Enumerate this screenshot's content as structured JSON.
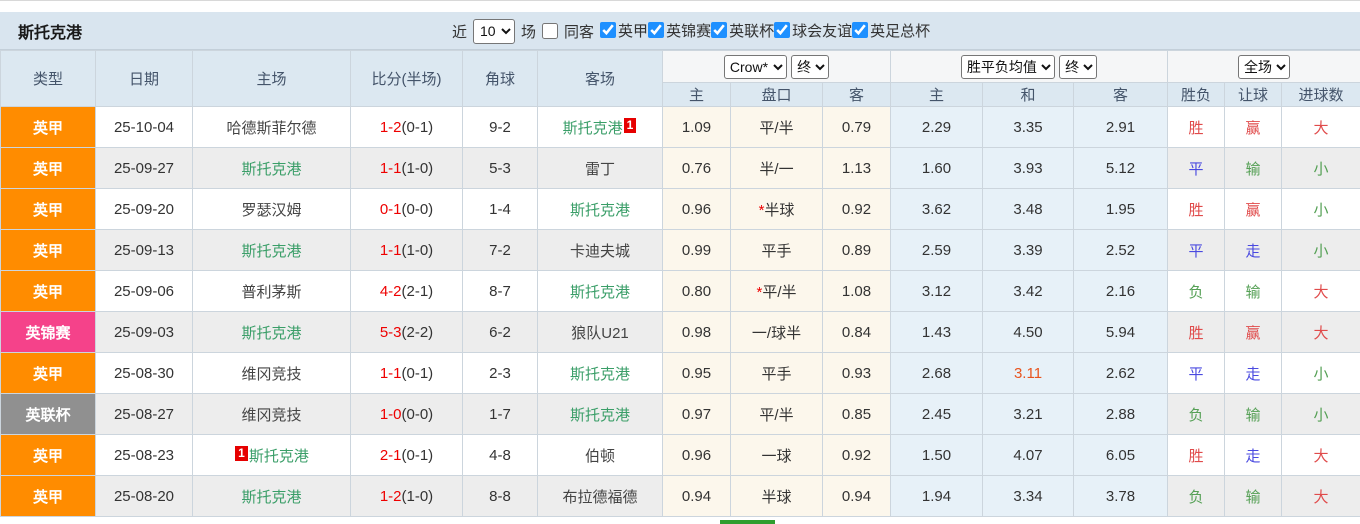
{
  "page": {
    "team_title": "斯托克港"
  },
  "filter_bar": {
    "near_label": "近",
    "match_count": "10",
    "games_label": "场",
    "same_away_label": "同客",
    "same_away_checked": false,
    "competitions": [
      {
        "label": "英甲",
        "checked": true
      },
      {
        "label": "英锦赛",
        "checked": true
      },
      {
        "label": "英联杯",
        "checked": true
      },
      {
        "label": "球会友谊",
        "checked": true
      },
      {
        "label": "英足总杯",
        "checked": true
      }
    ]
  },
  "table": {
    "headers": {
      "type": "类型",
      "date": "日期",
      "home": "主场",
      "score": "比分(半场)",
      "corner": "角球",
      "away": "客场",
      "odds_group": {
        "bookmaker_select": "Crow*",
        "status_select": "终",
        "sub": [
          "主",
          "盘口",
          "客"
        ]
      },
      "avg_group": {
        "metric_select": "胜平负均值",
        "status_select": "终",
        "sub": [
          "主",
          "和",
          "客"
        ]
      },
      "result_group": {
        "scope_select": "全场",
        "sub": [
          "胜负",
          "让球",
          "进球数"
        ]
      }
    },
    "league_colors": {
      "英甲": "#ff8c00",
      "英锦赛": "#f5428a",
      "英联杯": "#909090"
    },
    "rows": [
      {
        "league": "英甲",
        "date": "25-10-04",
        "home": {
          "name": "哈德斯菲尔德",
          "is_focus": false,
          "badge": null,
          "badge_pos": null
        },
        "score_ft": "1-2",
        "score_ht": "(0-1)",
        "corners": "9-2",
        "away": {
          "name": "斯托克港",
          "is_focus": true,
          "badge": "1",
          "badge_pos": "after"
        },
        "odds": {
          "home": "1.09",
          "handicap": "平/半",
          "star": false,
          "away": "0.79"
        },
        "avg": {
          "home": "2.29",
          "draw": "3.35",
          "away": "2.91",
          "draw_highlight": false
        },
        "result": {
          "win": "胜",
          "win_color": "red",
          "handicap": "赢",
          "handicap_color": "red",
          "goals": "大",
          "goals_color": "red"
        }
      },
      {
        "league": "英甲",
        "date": "25-09-27",
        "home": {
          "name": "斯托克港",
          "is_focus": true,
          "badge": null,
          "badge_pos": null
        },
        "score_ft": "1-1",
        "score_ht": "(1-0)",
        "corners": "5-3",
        "away": {
          "name": "雷丁",
          "is_focus": false,
          "badge": null,
          "badge_pos": null
        },
        "odds": {
          "home": "0.76",
          "handicap": "半/一",
          "star": false,
          "away": "1.13"
        },
        "avg": {
          "home": "1.60",
          "draw": "3.93",
          "away": "5.12",
          "draw_highlight": false
        },
        "result": {
          "win": "平",
          "win_color": "blue",
          "handicap": "输",
          "handicap_color": "green",
          "goals": "小",
          "goals_color": "green"
        }
      },
      {
        "league": "英甲",
        "date": "25-09-20",
        "home": {
          "name": "罗瑟汉姆",
          "is_focus": false,
          "badge": null,
          "badge_pos": null
        },
        "score_ft": "0-1",
        "score_ht": "(0-0)",
        "corners": "1-4",
        "away": {
          "name": "斯托克港",
          "is_focus": true,
          "badge": null,
          "badge_pos": null
        },
        "odds": {
          "home": "0.96",
          "handicap": "半球",
          "star": true,
          "away": "0.92"
        },
        "avg": {
          "home": "3.62",
          "draw": "3.48",
          "away": "1.95",
          "draw_highlight": false
        },
        "result": {
          "win": "胜",
          "win_color": "red",
          "handicap": "赢",
          "handicap_color": "red",
          "goals": "小",
          "goals_color": "green"
        }
      },
      {
        "league": "英甲",
        "date": "25-09-13",
        "home": {
          "name": "斯托克港",
          "is_focus": true,
          "badge": null,
          "badge_pos": null
        },
        "score_ft": "1-1",
        "score_ht": "(1-0)",
        "corners": "7-2",
        "away": {
          "name": "卡迪夫城",
          "is_focus": false,
          "badge": null,
          "badge_pos": null
        },
        "odds": {
          "home": "0.99",
          "handicap": "平手",
          "star": false,
          "away": "0.89"
        },
        "avg": {
          "home": "2.59",
          "draw": "3.39",
          "away": "2.52",
          "draw_highlight": false
        },
        "result": {
          "win": "平",
          "win_color": "blue",
          "handicap": "走",
          "handicap_color": "blue",
          "goals": "小",
          "goals_color": "green"
        }
      },
      {
        "league": "英甲",
        "date": "25-09-06",
        "home": {
          "name": "普利茅斯",
          "is_focus": false,
          "badge": null,
          "badge_pos": null
        },
        "score_ft": "4-2",
        "score_ht": "(2-1)",
        "corners": "8-7",
        "away": {
          "name": "斯托克港",
          "is_focus": true,
          "badge": null,
          "badge_pos": null
        },
        "odds": {
          "home": "0.80",
          "handicap": "平/半",
          "star": true,
          "away": "1.08"
        },
        "avg": {
          "home": "3.12",
          "draw": "3.42",
          "away": "2.16",
          "draw_highlight": false
        },
        "result": {
          "win": "负",
          "win_color": "green",
          "handicap": "输",
          "handicap_color": "green",
          "goals": "大",
          "goals_color": "red"
        }
      },
      {
        "league": "英锦赛",
        "date": "25-09-03",
        "home": {
          "name": "斯托克港",
          "is_focus": true,
          "badge": null,
          "badge_pos": null
        },
        "score_ft": "5-3",
        "score_ht": "(2-2)",
        "corners": "6-2",
        "away": {
          "name": "狼队U21",
          "is_focus": false,
          "badge": null,
          "badge_pos": null
        },
        "odds": {
          "home": "0.98",
          "handicap": "一/球半",
          "star": false,
          "away": "0.84"
        },
        "avg": {
          "home": "1.43",
          "draw": "4.50",
          "away": "5.94",
          "draw_highlight": false
        },
        "result": {
          "win": "胜",
          "win_color": "red",
          "handicap": "赢",
          "handicap_color": "red",
          "goals": "大",
          "goals_color": "red"
        }
      },
      {
        "league": "英甲",
        "date": "25-08-30",
        "home": {
          "name": "维冈竞技",
          "is_focus": false,
          "badge": null,
          "badge_pos": null
        },
        "score_ft": "1-1",
        "score_ht": "(0-1)",
        "corners": "2-3",
        "away": {
          "name": "斯托克港",
          "is_focus": true,
          "badge": null,
          "badge_pos": null
        },
        "odds": {
          "home": "0.95",
          "handicap": "平手",
          "star": false,
          "away": "0.93"
        },
        "avg": {
          "home": "2.68",
          "draw": "3.11",
          "away": "2.62",
          "draw_highlight": true
        },
        "result": {
          "win": "平",
          "win_color": "blue",
          "handicap": "走",
          "handicap_color": "blue",
          "goals": "小",
          "goals_color": "green"
        }
      },
      {
        "league": "英联杯",
        "date": "25-08-27",
        "home": {
          "name": "维冈竞技",
          "is_focus": false,
          "badge": null,
          "badge_pos": null
        },
        "score_ft": "1-0",
        "score_ht": "(0-0)",
        "corners": "1-7",
        "away": {
          "name": "斯托克港",
          "is_focus": true,
          "badge": null,
          "badge_pos": null
        },
        "odds": {
          "home": "0.97",
          "handicap": "平/半",
          "star": false,
          "away": "0.85"
        },
        "avg": {
          "home": "2.45",
          "draw": "3.21",
          "away": "2.88",
          "draw_highlight": false
        },
        "result": {
          "win": "负",
          "win_color": "green",
          "handicap": "输",
          "handicap_color": "green",
          "goals": "小",
          "goals_color": "green"
        }
      },
      {
        "league": "英甲",
        "date": "25-08-23",
        "home": {
          "name": "斯托克港",
          "is_focus": true,
          "badge": "1",
          "badge_pos": "before"
        },
        "score_ft": "2-1",
        "score_ht": "(0-1)",
        "corners": "4-8",
        "away": {
          "name": "伯顿",
          "is_focus": false,
          "badge": null,
          "badge_pos": null
        },
        "odds": {
          "home": "0.96",
          "handicap": "一球",
          "star": false,
          "away": "0.92"
        },
        "avg": {
          "home": "1.50",
          "draw": "4.07",
          "away": "6.05",
          "draw_highlight": false
        },
        "result": {
          "win": "胜",
          "win_color": "red",
          "handicap": "走",
          "handicap_color": "blue",
          "goals": "大",
          "goals_color": "red"
        }
      },
      {
        "league": "英甲",
        "date": "25-08-20",
        "home": {
          "name": "斯托克港",
          "is_focus": true,
          "badge": null,
          "badge_pos": null
        },
        "score_ft": "1-2",
        "score_ht": "(1-0)",
        "corners": "8-8",
        "away": {
          "name": "布拉德福德",
          "is_focus": false,
          "badge": null,
          "badge_pos": null
        },
        "odds": {
          "home": "0.94",
          "handicap": "半球",
          "star": false,
          "away": "0.94"
        },
        "avg": {
          "home": "1.94",
          "draw": "3.34",
          "away": "3.78",
          "draw_highlight": false
        },
        "result": {
          "win": "负",
          "win_color": "green",
          "handicap": "输",
          "handicap_color": "green",
          "goals": "大",
          "goals_color": "red"
        }
      }
    ]
  }
}
